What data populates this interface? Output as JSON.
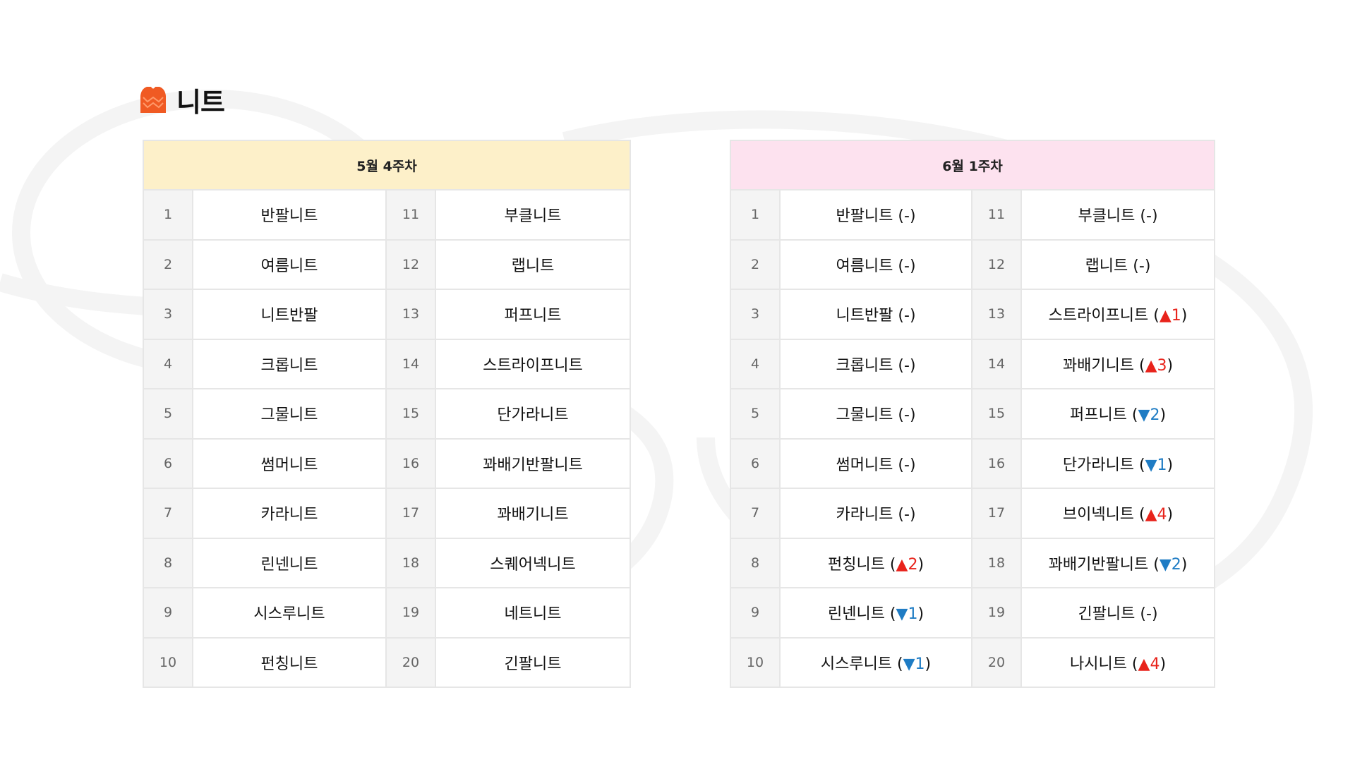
{
  "page": {
    "title": "니트",
    "title_icon": "sweater-icon",
    "accent": "#f05a23"
  },
  "left_table": {
    "header": "5월 4주차",
    "header_bg": "#fdf0c9",
    "rows": [
      {
        "n1": "1",
        "name1": "반팔니트",
        "n2": "11",
        "name2": "부클니트"
      },
      {
        "n1": "2",
        "name1": "여름니트",
        "n2": "12",
        "name2": "랩니트"
      },
      {
        "n1": "3",
        "name1": "니트반팔",
        "n2": "13",
        "name2": "퍼프니트"
      },
      {
        "n1": "4",
        "name1": "크롭니트",
        "n2": "14",
        "name2": "스트라이프니트"
      },
      {
        "n1": "5",
        "name1": "그물니트",
        "n2": "15",
        "name2": "단가라니트"
      },
      {
        "n1": "6",
        "name1": "썸머니트",
        "n2": "16",
        "name2": "꽈배기반팔니트"
      },
      {
        "n1": "7",
        "name1": "카라니트",
        "n2": "17",
        "name2": "꽈배기니트"
      },
      {
        "n1": "8",
        "name1": "린넨니트",
        "n2": "18",
        "name2": "스퀘어넥니트"
      },
      {
        "n1": "9",
        "name1": "시스루니트",
        "n2": "19",
        "name2": "네트니트"
      },
      {
        "n1": "10",
        "name1": "펀칭니트",
        "n2": "20",
        "name2": "긴팔니트"
      }
    ]
  },
  "right_table": {
    "header": "6월 1주차",
    "header_bg": "#fde2ef",
    "up_color": "#e8231b",
    "down_color": "#1f7cc4",
    "rows": [
      {
        "n1": "1",
        "name1": "반팔니트",
        "c1": {
          "dir": "none",
          "val": "-"
        },
        "n2": "11",
        "name2": "부클니트",
        "c2": {
          "dir": "none",
          "val": "-"
        }
      },
      {
        "n1": "2",
        "name1": "여름니트",
        "c1": {
          "dir": "none",
          "val": "-"
        },
        "n2": "12",
        "name2": "랩니트",
        "c2": {
          "dir": "none",
          "val": "-"
        }
      },
      {
        "n1": "3",
        "name1": "니트반팔",
        "c1": {
          "dir": "none",
          "val": "-"
        },
        "n2": "13",
        "name2": "스트라이프니트",
        "c2": {
          "dir": "up",
          "val": "1"
        }
      },
      {
        "n1": "4",
        "name1": "크롭니트",
        "c1": {
          "dir": "none",
          "val": "-"
        },
        "n2": "14",
        "name2": "꽈배기니트",
        "c2": {
          "dir": "up",
          "val": "3"
        }
      },
      {
        "n1": "5",
        "name1": "그물니트",
        "c1": {
          "dir": "none",
          "val": "-"
        },
        "n2": "15",
        "name2": "퍼프니트",
        "c2": {
          "dir": "down",
          "val": "2"
        }
      },
      {
        "n1": "6",
        "name1": "썸머니트",
        "c1": {
          "dir": "none",
          "val": "-"
        },
        "n2": "16",
        "name2": "단가라니트",
        "c2": {
          "dir": "down",
          "val": "1"
        }
      },
      {
        "n1": "7",
        "name1": "카라니트",
        "c1": {
          "dir": "none",
          "val": "-"
        },
        "n2": "17",
        "name2": "브이넥니트",
        "c2": {
          "dir": "up",
          "val": "4"
        }
      },
      {
        "n1": "8",
        "name1": "펀칭니트",
        "c1": {
          "dir": "up",
          "val": "2"
        },
        "n2": "18",
        "name2": "꽈배기반팔니트",
        "c2": {
          "dir": "down",
          "val": "2"
        }
      },
      {
        "n1": "9",
        "name1": "린넨니트",
        "c1": {
          "dir": "down",
          "val": "1"
        },
        "n2": "19",
        "name2": "긴팔니트",
        "c2": {
          "dir": "none",
          "val": "-"
        }
      },
      {
        "n1": "10",
        "name1": "시스루니트",
        "c1": {
          "dir": "down",
          "val": "1"
        },
        "n2": "20",
        "name2": "나시니트",
        "c2": {
          "dir": "up",
          "val": "4"
        }
      }
    ]
  }
}
